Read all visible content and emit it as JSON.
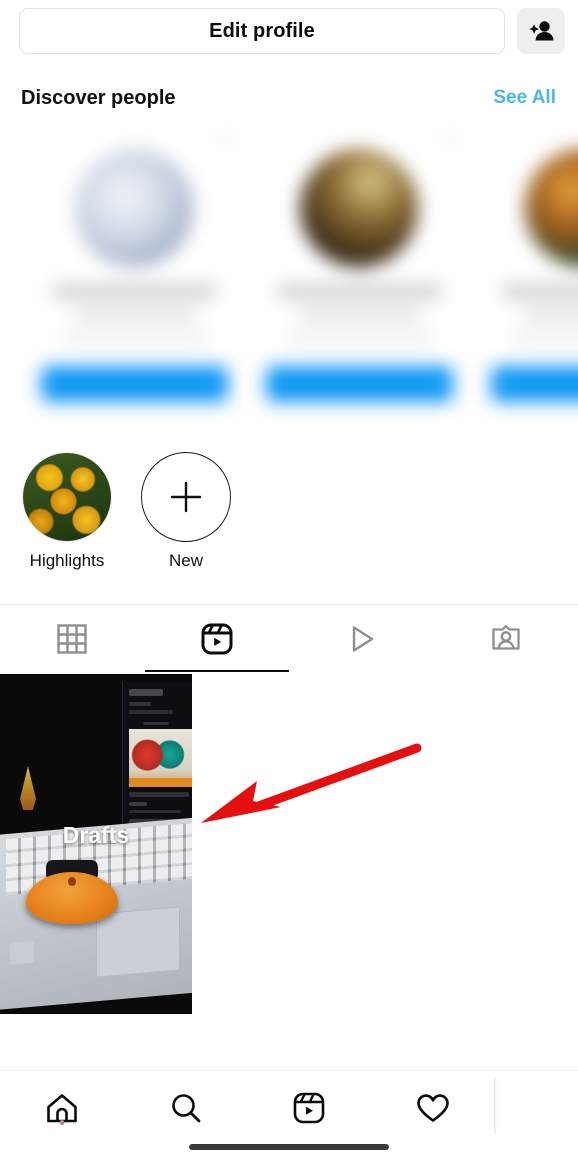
{
  "app": "Instagram Profile",
  "action_row": {
    "edit_profile_label": "Edit profile",
    "add_person_icon": "add-person-icon"
  },
  "discover": {
    "title": "Discover people",
    "see_all_label": "See All",
    "see_all_color": "#4db5e8",
    "cards": [
      {
        "name": "",
        "subtitle": "",
        "button_label": "",
        "blurred": true
      },
      {
        "name": "",
        "subtitle": "",
        "button_label": "",
        "blurred": true
      },
      {
        "name": "",
        "subtitle": "",
        "button_label": "",
        "blurred": true
      }
    ]
  },
  "highlights": {
    "items": [
      {
        "label": "Highlights",
        "type": "cover",
        "cover": "yellow-marigold-flowers"
      },
      {
        "label": "New",
        "type": "add",
        "icon": "plus-icon"
      }
    ]
  },
  "tabs": {
    "active_index": 1,
    "active_color": "#0b0b0b",
    "inactive_color": "#8e8e8e",
    "items": [
      {
        "icon": "grid-icon",
        "name": "tab-posts",
        "active": false
      },
      {
        "icon": "reels-icon",
        "name": "tab-reels",
        "active": true
      },
      {
        "icon": "play-icon",
        "name": "tab-videos",
        "active": false
      },
      {
        "icon": "tagged-icon",
        "name": "tab-tagged",
        "active": false
      }
    ]
  },
  "content": {
    "drafts": {
      "label": "Drafts",
      "thumbnail": "dark-photo-laptop-keyboard-orange-object-phone-instagram"
    }
  },
  "annotation": {
    "type": "arrow",
    "color": "#e50f0f",
    "direction": "left",
    "points_at": "Drafts"
  },
  "bottom_nav": {
    "items": [
      {
        "icon": "home-icon",
        "name": "nav-home",
        "active": true,
        "dot": true
      },
      {
        "icon": "search-icon",
        "name": "nav-search",
        "active": false,
        "dot": false
      },
      {
        "icon": "reels-icon",
        "name": "nav-reels",
        "active": false,
        "dot": false
      },
      {
        "icon": "heart-icon",
        "name": "nav-activity",
        "active": false,
        "dot": false
      }
    ],
    "home_indicator": true
  }
}
